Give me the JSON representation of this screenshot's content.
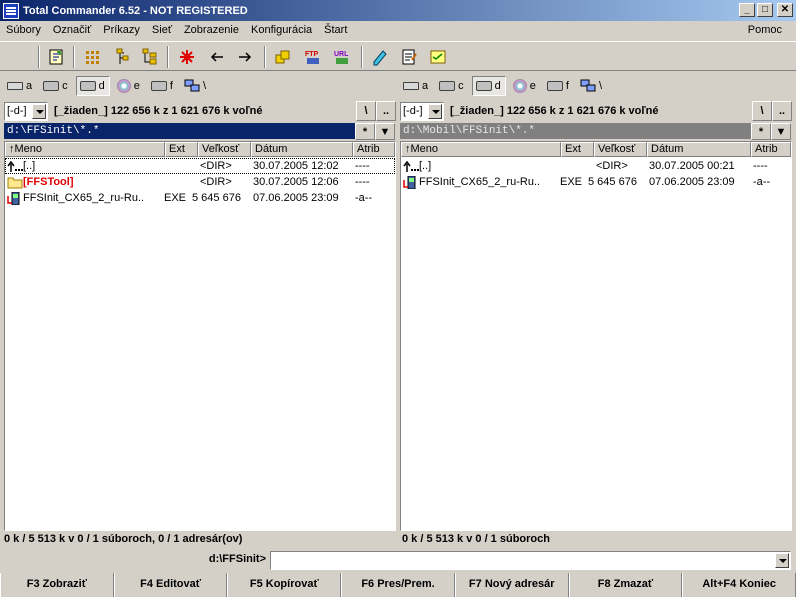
{
  "window": {
    "title": "Total Commander 6.52 - NOT REGISTERED"
  },
  "menu": {
    "items": [
      "Súbory",
      "Označiť",
      "Príkazy",
      "Sieť",
      "Zobrazenie",
      "Konfigurácia",
      "Štart"
    ],
    "help": "Pomoc"
  },
  "toolbar": {
    "icons": [
      "refresh-icon",
      "brief-view-icon",
      "tree-view-icon",
      "thumbnail-view-icon",
      "star-icon",
      "back-arrow-icon",
      "forward-arrow-icon",
      "pack-icon",
      "ftp-icon",
      "url-icon",
      "rename-icon",
      "edit-icon",
      "notes-icon"
    ]
  },
  "drives": {
    "left": [
      {
        "letter": "a",
        "icon": "floppy-icon"
      },
      {
        "letter": "c",
        "icon": "hdd-icon"
      },
      {
        "letter": "d",
        "icon": "hdd-icon",
        "active": true
      },
      {
        "letter": "e",
        "icon": "cd-icon"
      },
      {
        "letter": "f",
        "icon": "hdd-icon"
      },
      {
        "letter": "\\",
        "icon": "network-icon"
      }
    ],
    "right": [
      {
        "letter": "a",
        "icon": "floppy-icon"
      },
      {
        "letter": "c",
        "icon": "hdd-icon"
      },
      {
        "letter": "d",
        "icon": "hdd-icon",
        "active": true
      },
      {
        "letter": "e",
        "icon": "cd-icon"
      },
      {
        "letter": "f",
        "icon": "hdd-icon"
      },
      {
        "letter": "\\",
        "icon": "network-icon"
      }
    ]
  },
  "left": {
    "drive_combo": "[-d-]",
    "free": "[_žiaden_]  122 656 k z 1 621 676 k voľné",
    "root_btn": "\\",
    "up_btn": "..",
    "path": "d:\\FFSinit\\*.*",
    "star_btn": "*",
    "columns": [
      "↑Meno",
      "Ext",
      "Veľkosť",
      "Dátum",
      "Atrib"
    ],
    "files": [
      {
        "name": "[..]",
        "ext": "",
        "size": "<DIR>",
        "date": "30.07.2005 12:02",
        "attr": "----",
        "icon": "up-folder-icon",
        "style": "normal"
      },
      {
        "name": "[FFSTool]",
        "ext": "",
        "size": "<DIR>",
        "date": "30.07.2005 12:06",
        "attr": "----",
        "icon": "folder-icon",
        "style": "red"
      },
      {
        "name": "FFSInit_CX65_2_ru-Ru..",
        "ext": "EXE",
        "size": "5 645 676",
        "date": "07.06.2005 23:09",
        "attr": "-a--",
        "icon": "exe-icon",
        "style": "normal"
      }
    ],
    "status": "0 k / 5 513 k v 0 / 1 súboroch, 0 / 1 adresár(ov)"
  },
  "right": {
    "drive_combo": "[-d-]",
    "free": "[_žiaden_]  122 656 k z 1 621 676 k voľné",
    "root_btn": "\\",
    "up_btn": "..",
    "path": "d:\\Mobil\\FFSinit\\*.*",
    "star_btn": "*",
    "columns": [
      "↑Meno",
      "Ext",
      "Veľkosť",
      "Dátum",
      "Atrib"
    ],
    "files": [
      {
        "name": "[..]",
        "ext": "",
        "size": "<DIR>",
        "date": "30.07.2005 00:21",
        "attr": "----",
        "icon": "up-folder-icon",
        "style": "normal"
      },
      {
        "name": "FFSInit_CX65_2_ru-Ru..",
        "ext": "EXE",
        "size": "5 645 676",
        "date": "07.06.2005 23:09",
        "attr": "-a--",
        "icon": "exe-icon",
        "style": "normal"
      }
    ],
    "status": "0 k / 5 513 k v 0 / 1 súboroch"
  },
  "cmdline": {
    "label": "d:\\FFSinit>",
    "value": ""
  },
  "fkeys": [
    "F3 Zobraziť",
    "F4 Editovať",
    "F5 Kopírovať",
    "F6 Pres/Prem.",
    "F7 Nový adresár",
    "F8 Zmazať",
    "Alt+F4 Koniec"
  ]
}
